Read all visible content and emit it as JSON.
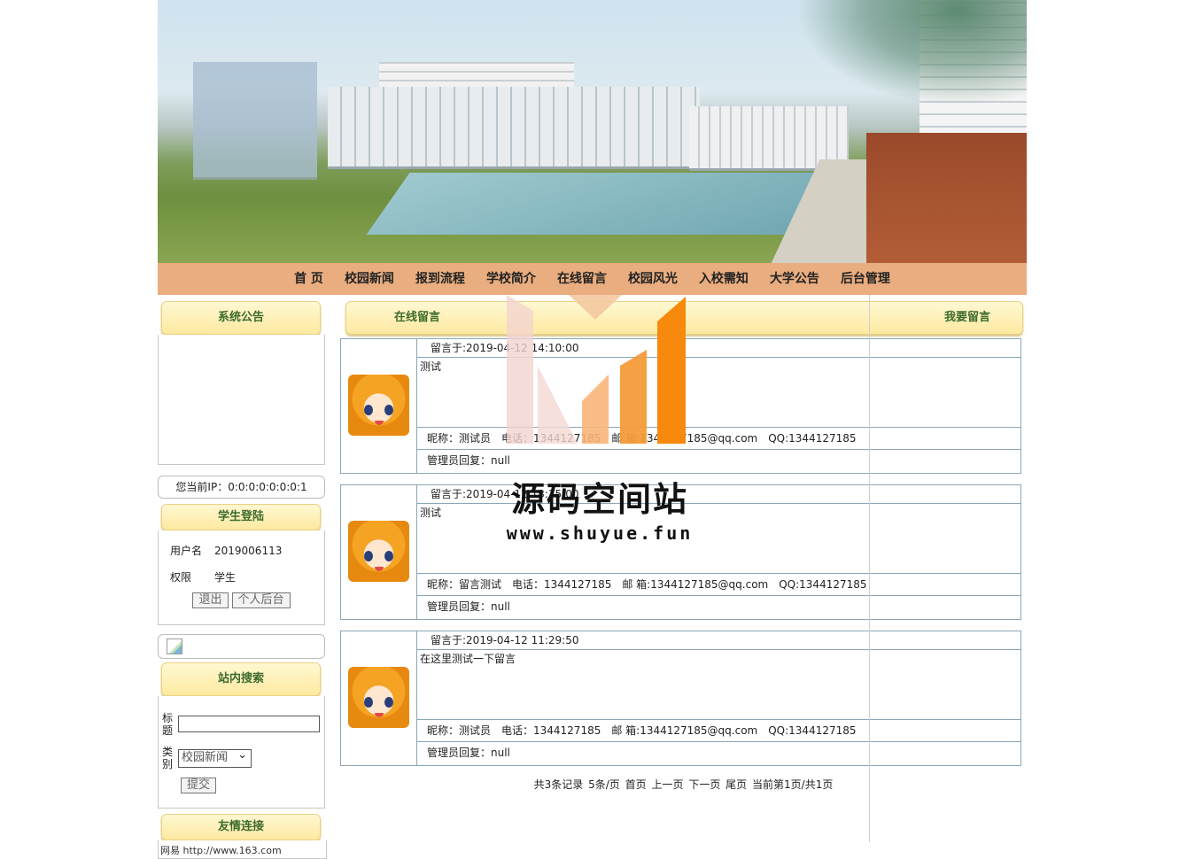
{
  "nav": [
    "首 页",
    "校园新闻",
    "报到流程",
    "学校简介",
    "在线留言",
    "校园风光",
    "入校需知",
    "大学公告",
    "后台管理"
  ],
  "sidebar": {
    "notice_title": "系统公告",
    "ip_text": "您当前IP：0:0:0:0:0:0:0:1",
    "login_title": "学生登陆",
    "username_label": "用户名",
    "username_value": "2019006113",
    "role_label": "权限",
    "role_value": "学生",
    "logout_btn": "退出",
    "profile_btn": "个人后台",
    "search_title": "站内搜索",
    "search_title_label": "标题",
    "search_type_label": "类别",
    "search_type_selected": "校园新闻",
    "search_submit": "提交",
    "links_title": "友情连接",
    "links_first": "网易 http://www.163.com"
  },
  "main": {
    "title": "在线留言",
    "action": "我要留言",
    "messages": [
      {
        "date": "留言于:2019-04-12 14:10:00",
        "body": "测试",
        "info": "昵称：测试员　电话：1344127185　邮 箱:1344127185@qq.com　QQ:1344127185",
        "reply": "管理员回复：null"
      },
      {
        "date": "留言于:2019-04-12 13:35:00",
        "body": "测试",
        "info": "昵称：留言测试　电话：1344127185　邮 箱:1344127185@qq.com　QQ:1344127185",
        "reply": "管理员回复：null"
      },
      {
        "date": "留言于:2019-04-12 11:29:50",
        "body": "在这里测试一下留言",
        "info": "昵称：测试员　电话：1344127185　邮 箱:1344127185@qq.com　QQ:1344127185",
        "reply": "管理员回复：null"
      }
    ],
    "pager": {
      "total": "共3条记录",
      "per_page": "5条/页",
      "first": "首页",
      "prev": "上一页",
      "next": "下一页",
      "last": "尾页",
      "current": "当前第1页/共1页"
    }
  },
  "watermark": {
    "name": "源码空间站",
    "url": "www.shuyue.fun"
  },
  "colors": {
    "nav_bg": "#e9ad7f",
    "title_text": "#3c6b2d",
    "title_bg": "#fde9a0",
    "border": "#8aa6b8",
    "watermark_orange": "#f7890c"
  }
}
